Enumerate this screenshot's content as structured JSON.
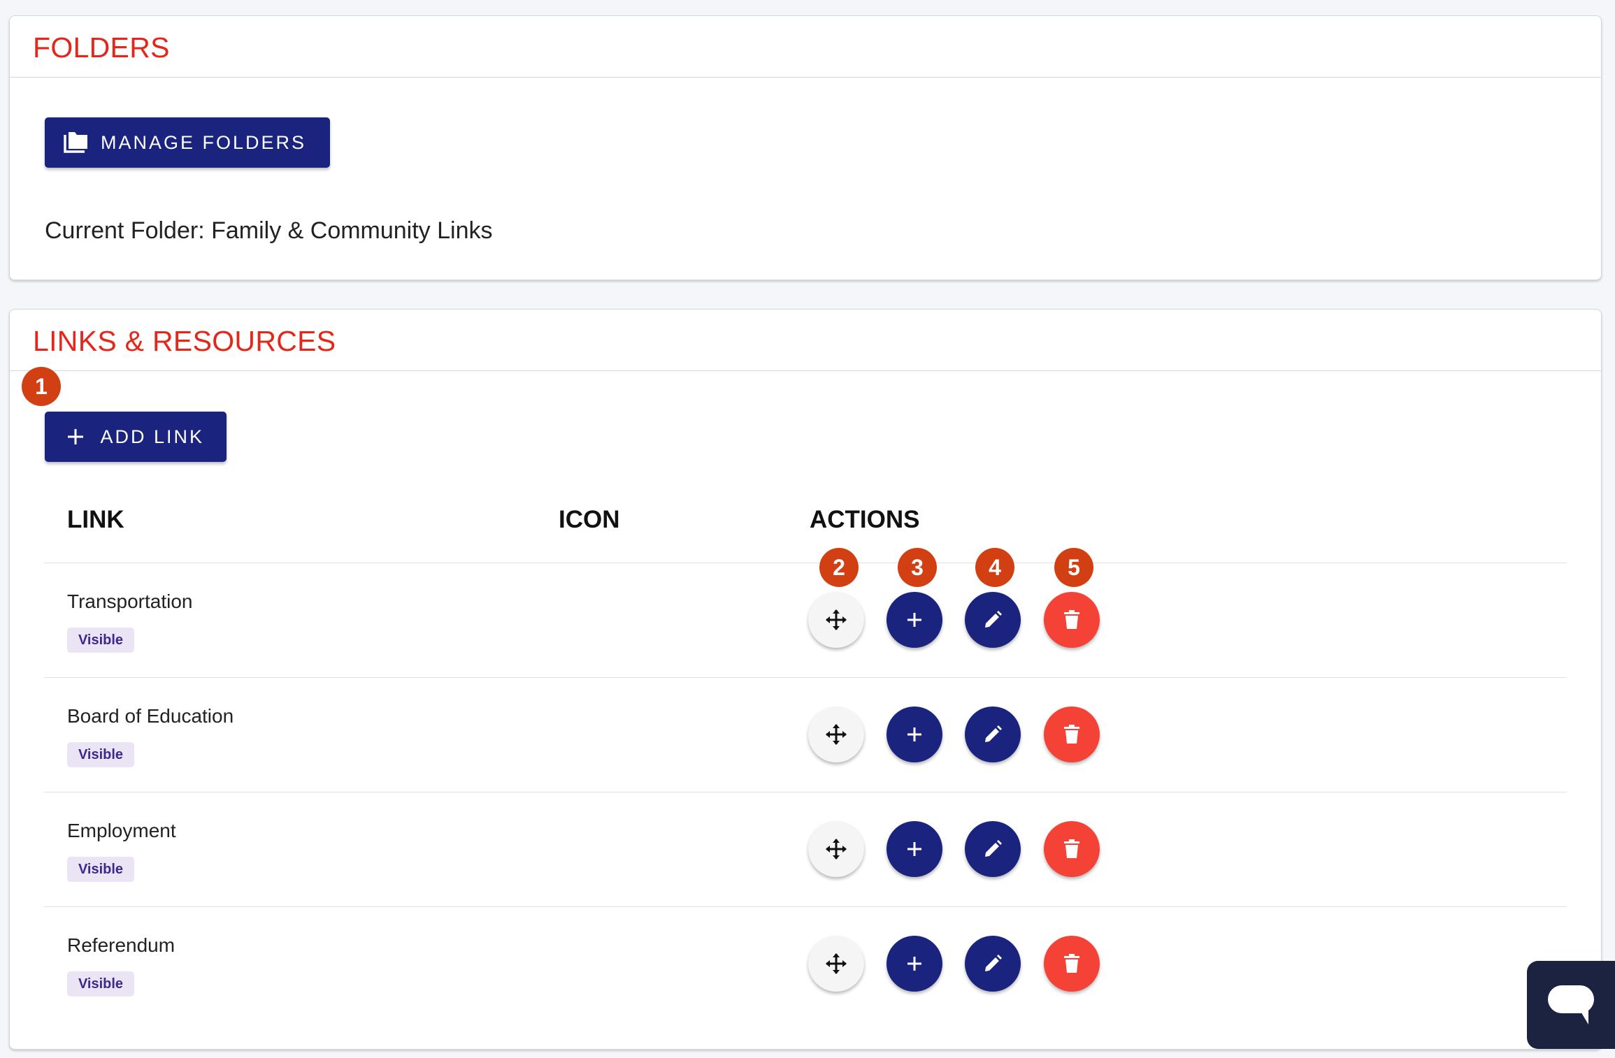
{
  "folders_card": {
    "title": "FOLDERS",
    "manage_button_label": "MANAGE FOLDERS",
    "current_folder_label": "Current Folder: Family & Community Links"
  },
  "links_card": {
    "title": "LINKS & RESOURCES",
    "add_button_label": "ADD LINK",
    "columns": {
      "link": "LINK",
      "icon": "ICON",
      "actions": "ACTIONS"
    },
    "rows": [
      {
        "name": "Transportation",
        "status": "Visible"
      },
      {
        "name": "Board of Education",
        "status": "Visible"
      },
      {
        "name": "Employment",
        "status": "Visible"
      },
      {
        "name": "Referendum",
        "status": "Visible"
      }
    ]
  },
  "callouts": [
    "1",
    "2",
    "3",
    "4",
    "5"
  ],
  "icons": {
    "manage_folders": "folders-icon",
    "add_link": "plus-icon",
    "move": "move-icon",
    "add_child": "plus-icon",
    "edit": "pencil-icon",
    "delete": "trash-icon",
    "chat": "chat-bubble-icon"
  },
  "colors": {
    "primary": "#1a237e",
    "title_red": "#e3271b",
    "delete_red": "#f44336",
    "callout_badge": "#d23f13",
    "chip_bg": "#ebe4f5",
    "chat_widget": "#1b2340"
  }
}
